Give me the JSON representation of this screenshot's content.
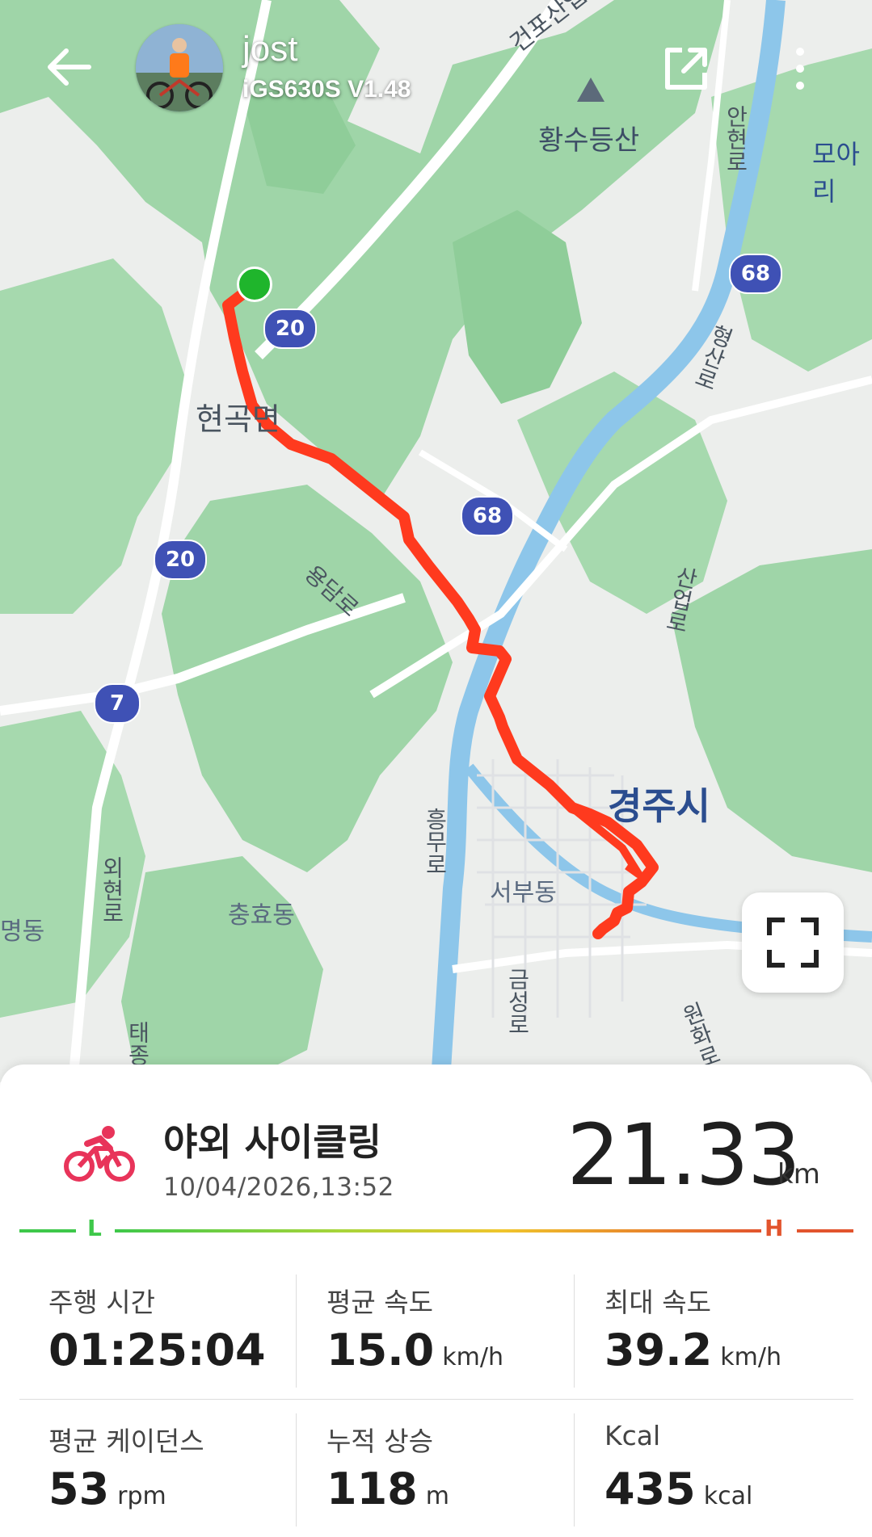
{
  "header": {
    "user_name": "jost",
    "device": "iGS630S  V1.48",
    "back_icon": "arrow-left-icon",
    "share_icon": "share-external-icon",
    "more_icon": "more-vertical-icon"
  },
  "map": {
    "labels": {
      "place_hyeongok": "현곡면",
      "place_gyeongju": "경주시",
      "place_seobu": "서부동",
      "place_chunghyo": "충효동",
      "place_myeong": "명동",
      "place_moa": "모아리",
      "mountain_hwangsu": "황수등산",
      "road_geonpo": "건포산업로",
      "road_anhyeon": "안현로",
      "road_hyeongsan": "형산로",
      "road_yongdam": "용담로",
      "road_saneop": "산업로",
      "road_heungmu": "흥무로",
      "road_oehyeon": "외현로",
      "road_geumseong": "금성로",
      "road_wonhwa": "원화로",
      "road_tae": "태종"
    },
    "shields": [
      "20",
      "20",
      "68",
      "68",
      "7"
    ],
    "fullscreen_icon": "fullscreen-icon"
  },
  "activity": {
    "type_label": "야외 사이클링",
    "icon": "cycling-icon",
    "date": "10/04/2026,13:52",
    "distance": "21.33",
    "distance_unit": "km",
    "scale_low": "L",
    "scale_high": "H"
  },
  "stats": [
    {
      "label": "주행 시간",
      "value": "01:25:04",
      "unit": ""
    },
    {
      "label": "평균 속도",
      "value": "15.0",
      "unit": "km/h"
    },
    {
      "label": "최대 속도",
      "value": "39.2",
      "unit": "km/h"
    },
    {
      "label": "평균 케이던스",
      "value": "53",
      "unit": "rpm"
    },
    {
      "label": "누적 상승",
      "value": "118",
      "unit": "m"
    },
    {
      "label": "Kcal",
      "value": "435",
      "unit": "kcal"
    }
  ],
  "colors": {
    "route": "#ff3a1e",
    "start_marker": "#1fb52c",
    "cycling_icon": "#e8345a",
    "scale_low": "#3ec84a",
    "scale_high": "#e2542d"
  }
}
